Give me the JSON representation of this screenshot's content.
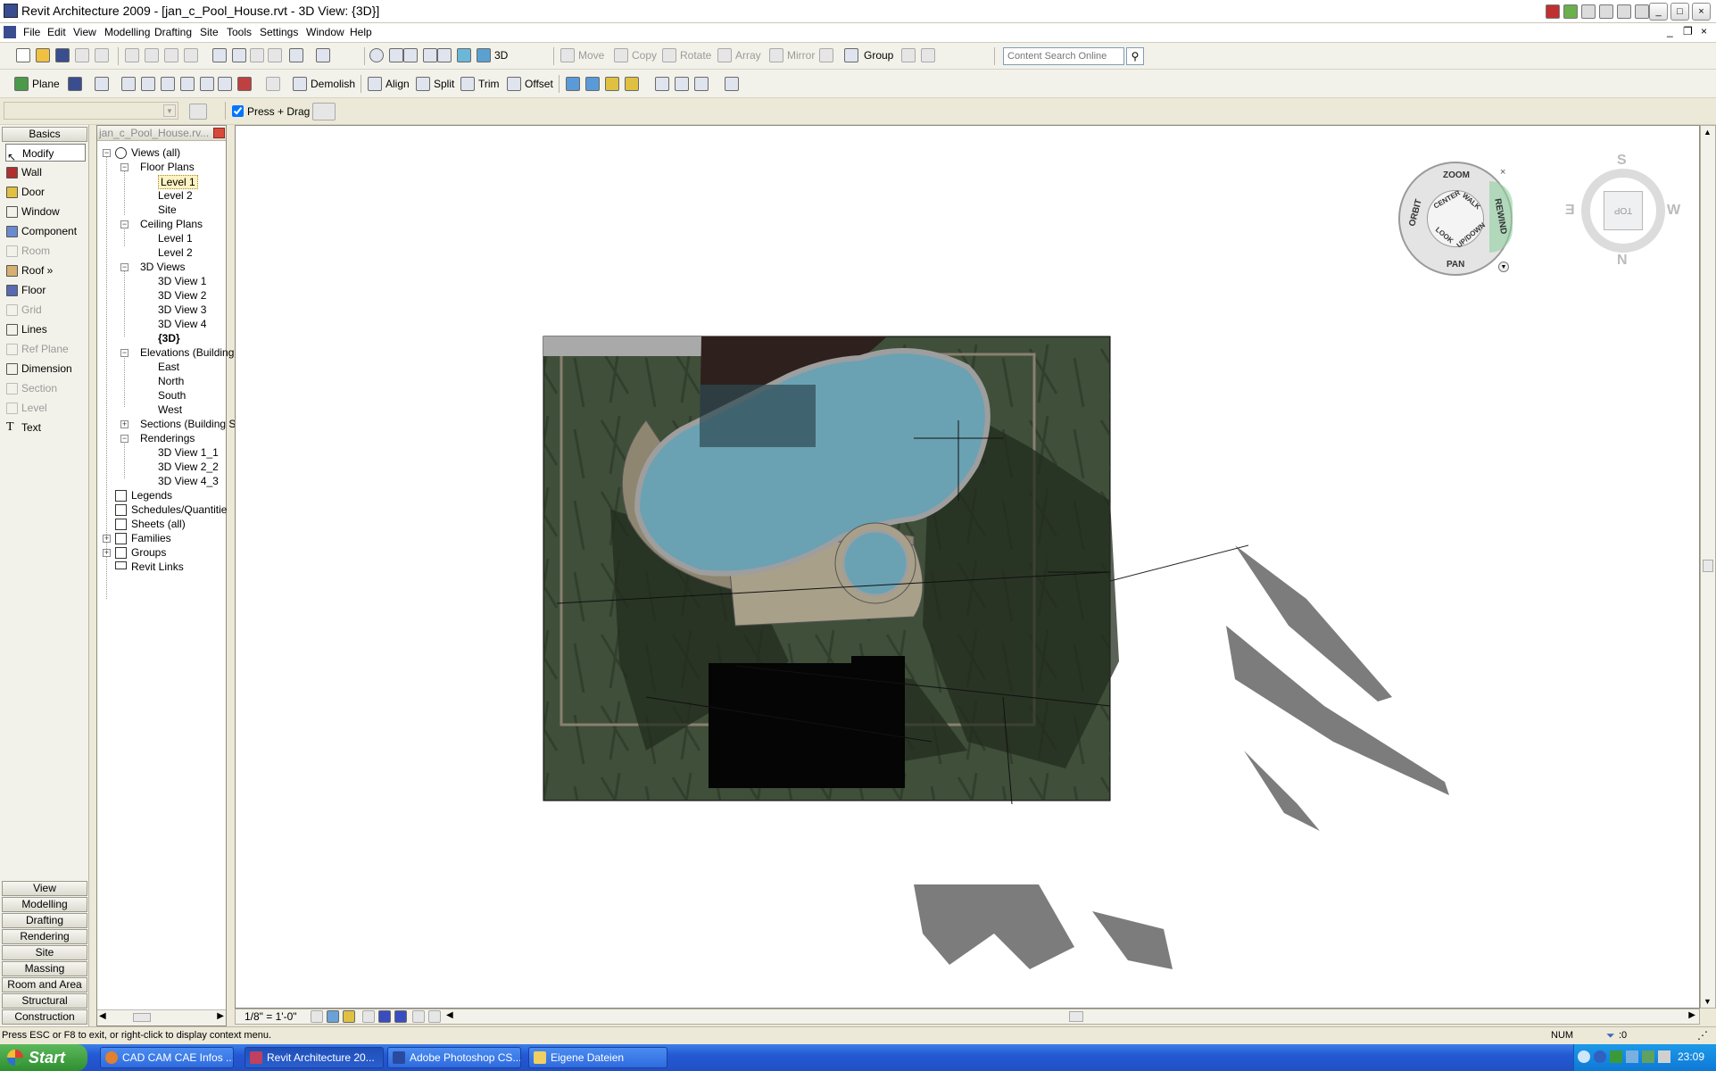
{
  "window": {
    "title": "Revit Architecture 2009 - [jan_c_Pool_House.rvt - 3D View: {3D}]"
  },
  "menu": {
    "items": [
      "File",
      "Edit",
      "View",
      "Modelling",
      "Drafting",
      "Site",
      "Tools",
      "Settings",
      "Window",
      "Help"
    ]
  },
  "toolbar1": {
    "view3d_label": "3D",
    "move_label": "Move",
    "copy_label": "Copy",
    "rotate_label": "Rotate",
    "array_label": "Array",
    "mirror_label": "Mirror",
    "group_label": "Group",
    "search_placeholder": "Content Search Online"
  },
  "toolbar2": {
    "plane_label": "Plane",
    "demolish_label": "Demolish",
    "align_label": "Align",
    "split_label": "Split",
    "trim_label": "Trim",
    "offset_label": "Offset"
  },
  "options_bar": {
    "press_drag_label": "Press + Drag",
    "press_drag_checked": true
  },
  "design_bar": {
    "active_tab": "Basics",
    "items": [
      {
        "label": "Modify",
        "enabled": true,
        "icon": "cursor-icon"
      },
      {
        "label": "Wall",
        "enabled": true,
        "icon": "wall-icon"
      },
      {
        "label": "Door",
        "enabled": true,
        "icon": "door-icon"
      },
      {
        "label": "Window",
        "enabled": true,
        "icon": "window-icon"
      },
      {
        "label": "Component",
        "enabled": true,
        "icon": "component-icon"
      },
      {
        "label": "Room",
        "enabled": false,
        "icon": "room-icon"
      },
      {
        "label": "Roof »",
        "enabled": true,
        "icon": "roof-icon"
      },
      {
        "label": "Floor",
        "enabled": true,
        "icon": "floor-icon"
      },
      {
        "label": "Grid",
        "enabled": false,
        "icon": "grid-icon"
      },
      {
        "label": "Lines",
        "enabled": true,
        "icon": "lines-icon"
      },
      {
        "label": "Ref Plane",
        "enabled": false,
        "icon": "ref-plane-icon"
      },
      {
        "label": "Dimension",
        "enabled": true,
        "icon": "dimension-icon"
      },
      {
        "label": "Section",
        "enabled": false,
        "icon": "section-icon"
      },
      {
        "label": "Level",
        "enabled": false,
        "icon": "level-icon"
      },
      {
        "label": "Text",
        "enabled": true,
        "icon": "text-icon"
      }
    ],
    "bottom_tabs": [
      "View",
      "Modelling",
      "Drafting",
      "Rendering",
      "Site",
      "Massing",
      "Room and Area",
      "Structural",
      "Construction"
    ]
  },
  "project_browser": {
    "header": "jan_c_Pool_House.rv...",
    "nodes": {
      "views_all": "Views (all)",
      "floor_plans": "Floor Plans",
      "fp_level1": "Level 1",
      "fp_level2": "Level 2",
      "fp_site": "Site",
      "ceiling_plans": "Ceiling Plans",
      "cp_level1": "Level 1",
      "cp_level2": "Level 2",
      "views3d": "3D Views",
      "v3d1": "3D View 1",
      "v3d2": "3D View 2",
      "v3d3": "3D View 3",
      "v3d4": "3D View 4",
      "v3d_current": "{3D}",
      "elevations": "Elevations (Building",
      "el_east": "East",
      "el_north": "North",
      "el_south": "South",
      "el_west": "West",
      "sections": "Sections (Building S",
      "renderings": "Renderings",
      "r1": "3D View 1_1",
      "r2": "3D View 2_2",
      "r3": "3D View 4_3",
      "legends": "Legends",
      "schedules": "Schedules/Quantitie",
      "sheets": "Sheets (all)",
      "families": "Families",
      "groups": "Groups",
      "revit_links": "Revit Links"
    }
  },
  "nav_wheel": {
    "labels": [
      "ZOOM",
      "ORBIT",
      "CENTER",
      "WALK",
      "REWIND",
      "LOOK",
      "UP/DOWN",
      "PAN"
    ]
  },
  "viewcube": {
    "face": "TOP",
    "directions": [
      "S",
      "E",
      "W",
      "N"
    ]
  },
  "view_control_bar": {
    "scale": "1/8\" = 1'-0\""
  },
  "status_bar": {
    "message": "Press ESC or F8 to exit, or right-click to display context menu.",
    "num": "NUM",
    "filter_count": ":0"
  },
  "taskbar": {
    "start_label": "Start",
    "tasks": [
      {
        "label": "CAD CAM CAE Infos ...",
        "active": false
      },
      {
        "label": "Revit Architecture 20...",
        "active": true
      },
      {
        "label": "Adobe Photoshop CS...",
        "active": false
      },
      {
        "label": "Eigene Dateien",
        "active": false
      }
    ],
    "clock": "23:09"
  }
}
